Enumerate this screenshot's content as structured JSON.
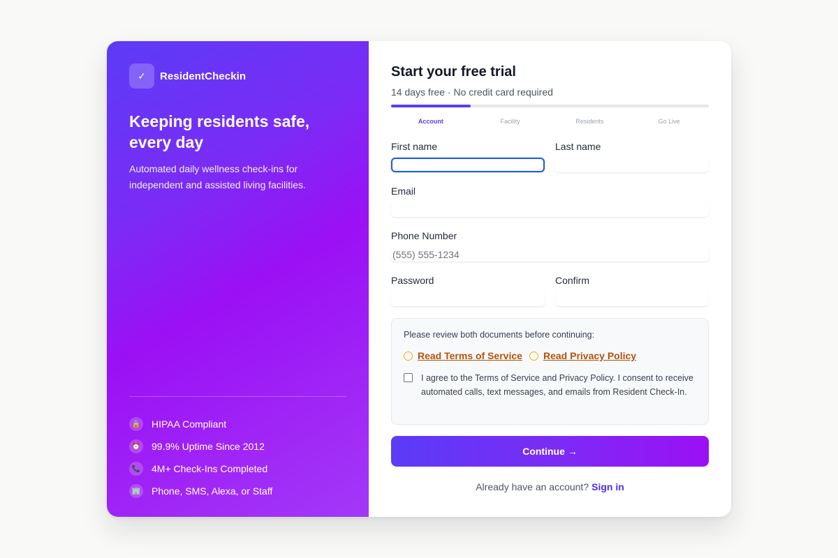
{
  "brand": {
    "icon": "check-icon",
    "icon_glyph": "✓",
    "name": "ResidentCheckin"
  },
  "hero": {
    "title": "Keeping residents safe, every day",
    "subtitle": "Automated daily wellness check-ins for independent and assisted living facilities."
  },
  "features": [
    {
      "icon": "lock-icon",
      "glyph": "🔒",
      "label": "HIPAA Compliant"
    },
    {
      "icon": "clock-icon",
      "glyph": "⏰",
      "label": "99.9% Uptime Since 2012"
    },
    {
      "icon": "phone-icon",
      "glyph": "📞",
      "label": "4M+ Check-Ins Completed"
    },
    {
      "icon": "building-icon",
      "glyph": "🏢",
      "label": "Phone, SMS, Alexa, or Staff"
    }
  ],
  "form": {
    "title": "Start your free trial",
    "subtitle": "14 days free · No credit card required",
    "progress": 0.25,
    "steps": [
      "Account",
      "Facility",
      "Residents",
      "Go Live"
    ],
    "active_step": 0,
    "fields": {
      "first_name": {
        "label": "First name",
        "value": "",
        "placeholder": ""
      },
      "last_name": {
        "label": "Last name",
        "value": "",
        "placeholder": ""
      },
      "email": {
        "label": "Email",
        "value": "",
        "placeholder": ""
      },
      "phone": {
        "label": "Phone Number",
        "value": "",
        "placeholder": "(555) 555-1234"
      },
      "password": {
        "label": "Password",
        "value": "",
        "placeholder": ""
      },
      "confirm": {
        "label": "Confirm",
        "value": "",
        "placeholder": ""
      }
    },
    "review": {
      "prompt": "Please review both documents before continuing:",
      "terms_link": "Read Terms of Service",
      "privacy_link": "Read Privacy Policy",
      "consent": "I agree to the Terms of Service and Privacy Policy. I consent to receive automated calls, text messages, and emails from Resident Check-In.",
      "consent_checked": false
    },
    "continue_label": "Continue →",
    "footer_text": "Already have an account?",
    "signin_label": "Sign in"
  },
  "colors": {
    "accent": "#5b3cf6",
    "accent_end": "#9b10f5",
    "link_warning": "#b45309",
    "focus": "#1f5fd8"
  }
}
